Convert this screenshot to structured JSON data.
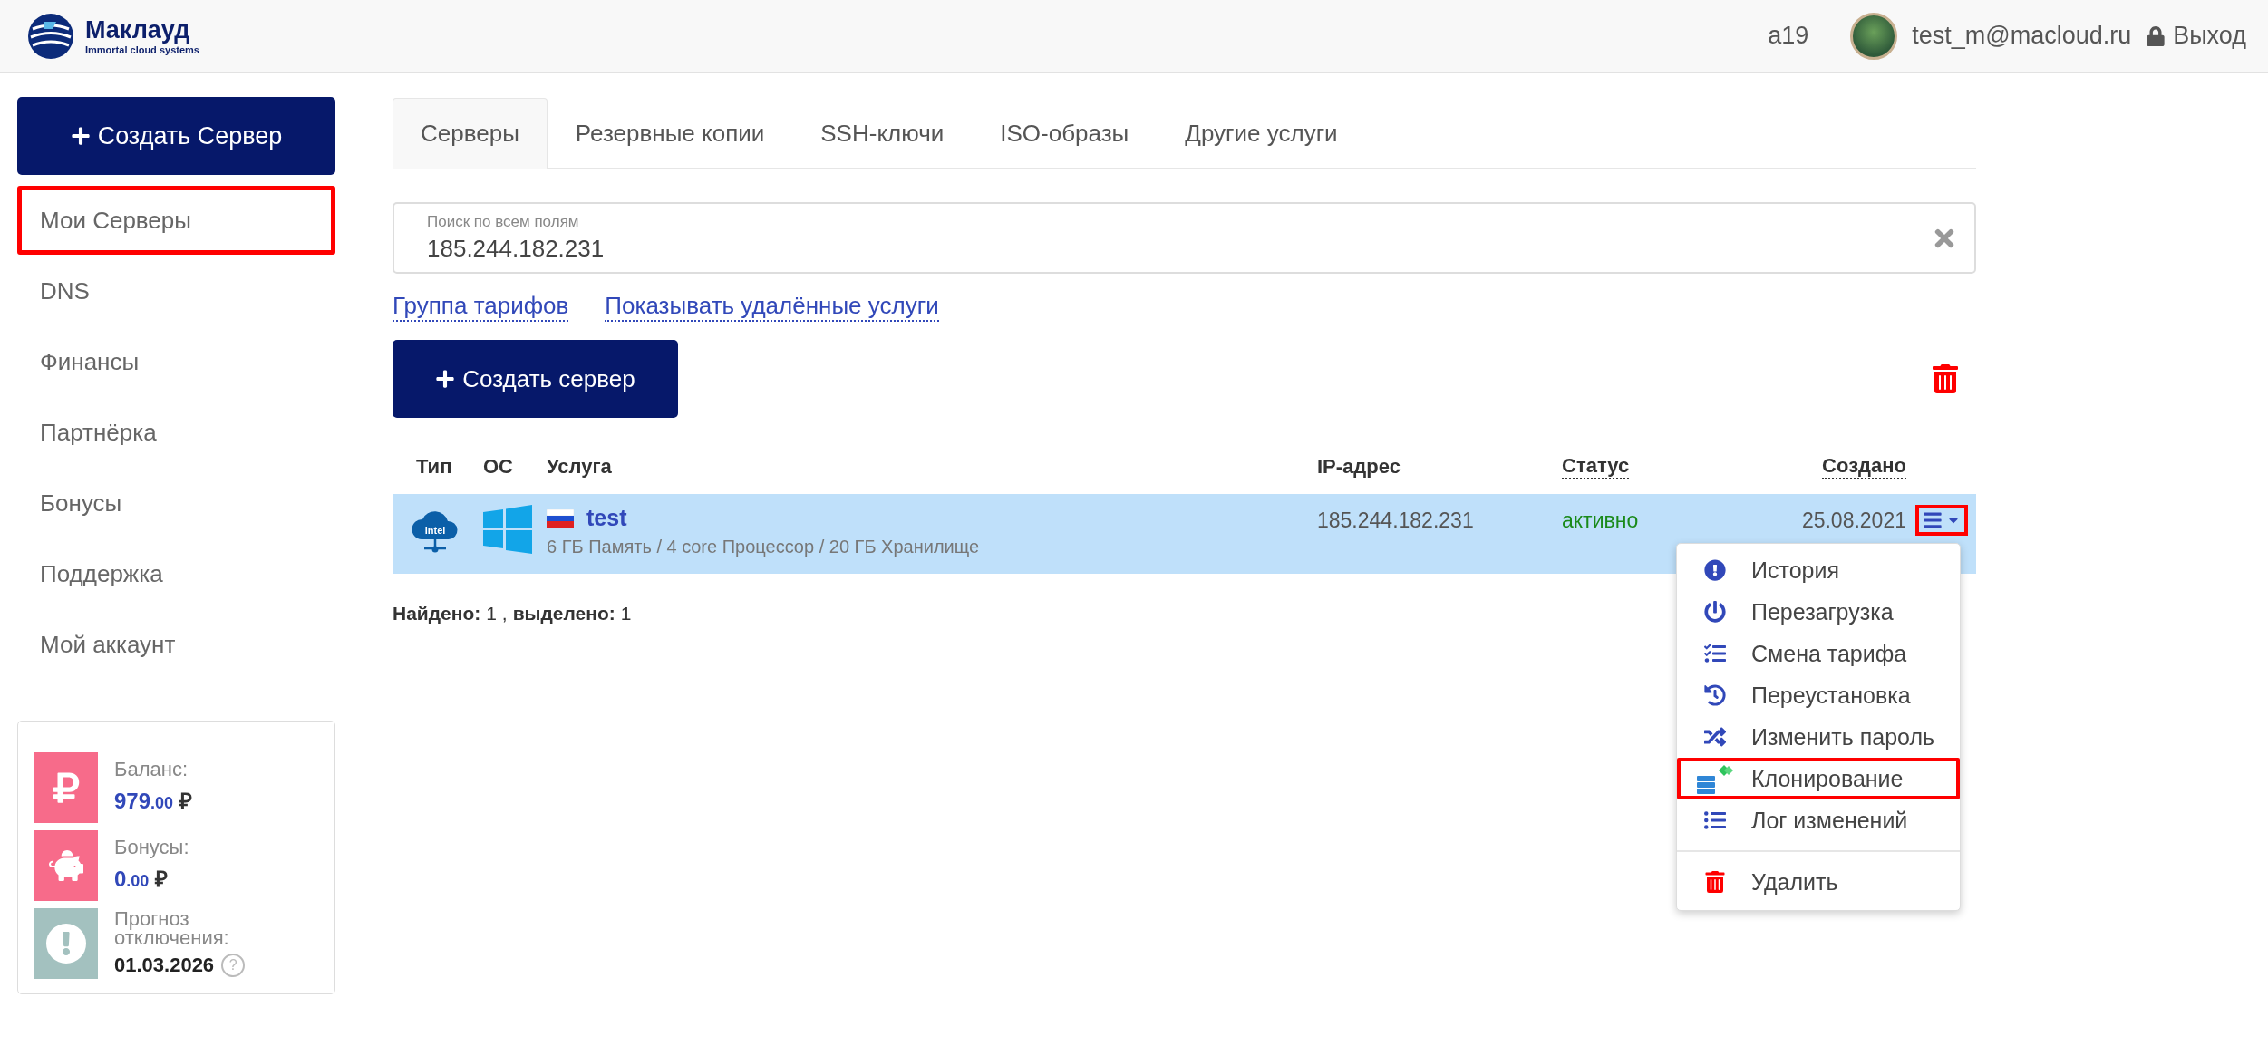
{
  "header": {
    "brand": "Маклауд",
    "tagline": "Immortal cloud systems",
    "account_id": "a19",
    "email": "test_m@macloud.ru",
    "logout": "Выход"
  },
  "sidebar": {
    "create_button": "Создать Сервер",
    "items": [
      {
        "label": "Мои Серверы",
        "highlighted": true
      },
      {
        "label": "DNS",
        "highlighted": false
      },
      {
        "label": "Финансы",
        "highlighted": false
      },
      {
        "label": "Партнёрка",
        "highlighted": false
      },
      {
        "label": "Бонусы",
        "highlighted": false
      },
      {
        "label": "Поддержка",
        "highlighted": false
      },
      {
        "label": "Мой аккаунт",
        "highlighted": false
      }
    ],
    "balance_card": [
      {
        "kind": "ruble",
        "label": "Баланс:",
        "amount": "979",
        "cents": ".00",
        "currency": "₽"
      },
      {
        "kind": "piggy",
        "label": "Бонусы:",
        "amount": "0",
        "cents": ".00",
        "currency": "₽"
      },
      {
        "kind": "forecast",
        "label": "Прогноз отключения:",
        "date": "01.03.2026",
        "help": "?"
      }
    ]
  },
  "tabs": [
    {
      "label": "Серверы",
      "selected": true
    },
    {
      "label": "Резервные копии",
      "selected": false
    },
    {
      "label": "SSH-ключи",
      "selected": false
    },
    {
      "label": "ISO-образы",
      "selected": false
    },
    {
      "label": "Другие услуги",
      "selected": false
    }
  ],
  "search": {
    "label": "Поиск по всем полям",
    "value": "185.244.182.231"
  },
  "filter_links": [
    "Группа тарифов",
    "Показывать удалённые услуги"
  ],
  "create_button": "Создать сервер",
  "table": {
    "columns": [
      {
        "label": "Тип",
        "sortable": false
      },
      {
        "label": "ОС",
        "sortable": false
      },
      {
        "label": "Услуга",
        "sortable": false
      },
      {
        "label": "IP-адрес",
        "sortable": false
      },
      {
        "label": "Статус",
        "sortable": true
      },
      {
        "label": "Создано",
        "sortable": true
      }
    ],
    "rows": [
      {
        "selected": true,
        "type_icon_text": "intel",
        "name": "test",
        "specs": "6 ГБ Память / 4 core Процессор / 20 ГБ Хранилище",
        "ip": "185.244.182.231",
        "status": "активно",
        "created": "25.08.2021",
        "menu_highlighted": true
      }
    ]
  },
  "summary": {
    "found_label": "Найдено:",
    "found": "1 ,",
    "selected_label": "выделено:",
    "selected": "1"
  },
  "context_menu": [
    {
      "kind": "info",
      "label": "История",
      "highlighted": false
    },
    {
      "kind": "power",
      "label": "Перезагрузка",
      "highlighted": false
    },
    {
      "kind": "checklist",
      "label": "Смена тарифа",
      "highlighted": false
    },
    {
      "kind": "history",
      "label": "Переустановка",
      "highlighted": false
    },
    {
      "kind": "shuffle",
      "label": "Изменить пароль",
      "highlighted": false
    },
    {
      "kind": "clone",
      "label": "Клонирование",
      "highlighted": true
    },
    {
      "kind": "list",
      "label": "Лог изменений",
      "highlighted": false
    },
    {
      "kind": "delete",
      "label": "Удалить",
      "highlighted": false
    }
  ]
}
